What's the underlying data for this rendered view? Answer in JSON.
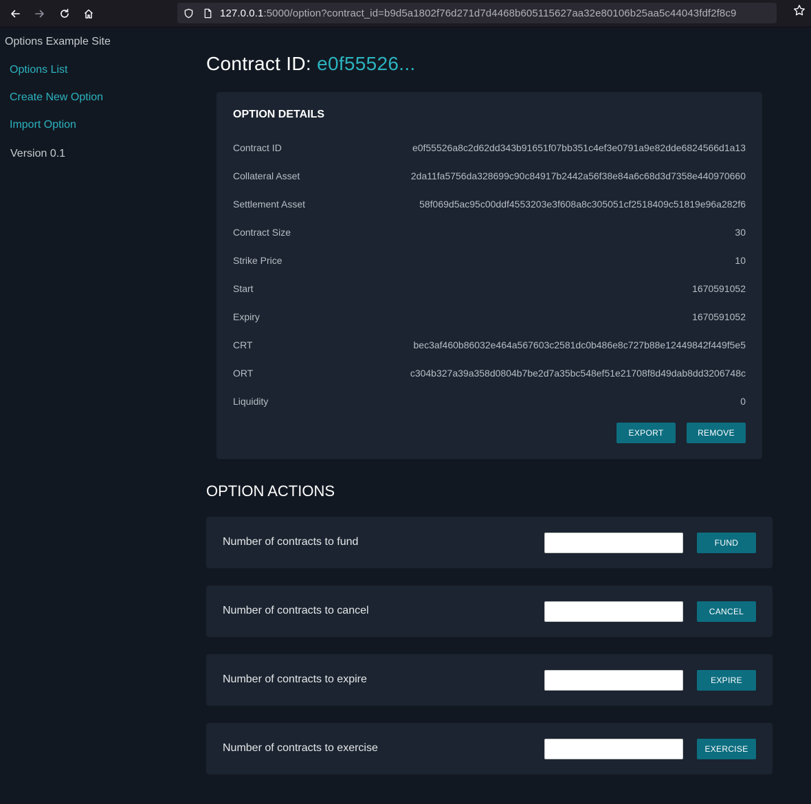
{
  "browser": {
    "url_host": "127.0.0.1",
    "url_rest": ":5000/option?contract_id=b9d5a1802f76d271d7d4468b605115627aa32e80106b25aa5c44043fdf2f8c9"
  },
  "sidebar": {
    "site_title": "Options Example Site",
    "links": [
      "Options List",
      "Create New Option",
      "Import Option"
    ],
    "version": "Version 0.1"
  },
  "header": {
    "title_prefix": "Contract ID:",
    "contract_short": "e0f55526..."
  },
  "details": {
    "heading": "OPTION DETAILS",
    "rows": [
      {
        "label": "Contract ID",
        "value": "e0f55526a8c2d62dd343b91651f07bb351c4ef3e0791a9e82dde6824566d1a13"
      },
      {
        "label": "Collateral Asset",
        "value": "2da11fa5756da328699c90c84917b2442a56f38e84a6c68d3d7358e440970660"
      },
      {
        "label": "Settlement Asset",
        "value": "58f069d5ac95c00ddf4553203e3f608a8c305051cf2518409c51819e96a282f6"
      },
      {
        "label": "Contract Size",
        "value": "30"
      },
      {
        "label": "Strike Price",
        "value": "10"
      },
      {
        "label": "Start",
        "value": "1670591052"
      },
      {
        "label": "Expiry",
        "value": "1670591052"
      },
      {
        "label": "CRT",
        "value": "bec3af460b86032e464a567603c2581dc0b486e8c727b88e12449842f449f5e5"
      },
      {
        "label": "ORT",
        "value": "c304b327a39a358d0804b7be2d7a35bc548ef51e21708f8d49dab8dd3206748c"
      },
      {
        "label": "Liquidity",
        "value": "0"
      }
    ],
    "export_label": "EXPORT",
    "remove_label": "REMOVE"
  },
  "actions": {
    "title": "OPTION ACTIONS",
    "items": [
      {
        "label": "Number of contracts to fund",
        "button": "FUND",
        "value": ""
      },
      {
        "label": "Number of contracts to cancel",
        "button": "CANCEL",
        "value": ""
      },
      {
        "label": "Number of contracts to expire",
        "button": "EXPIRE",
        "value": ""
      },
      {
        "label": "Number of contracts to exercise",
        "button": "EXERCISE",
        "value": ""
      }
    ]
  },
  "colors": {
    "background": "#121821",
    "card": "#1b2430",
    "accent": "#2bb3c0",
    "button": "#0d6e80"
  }
}
